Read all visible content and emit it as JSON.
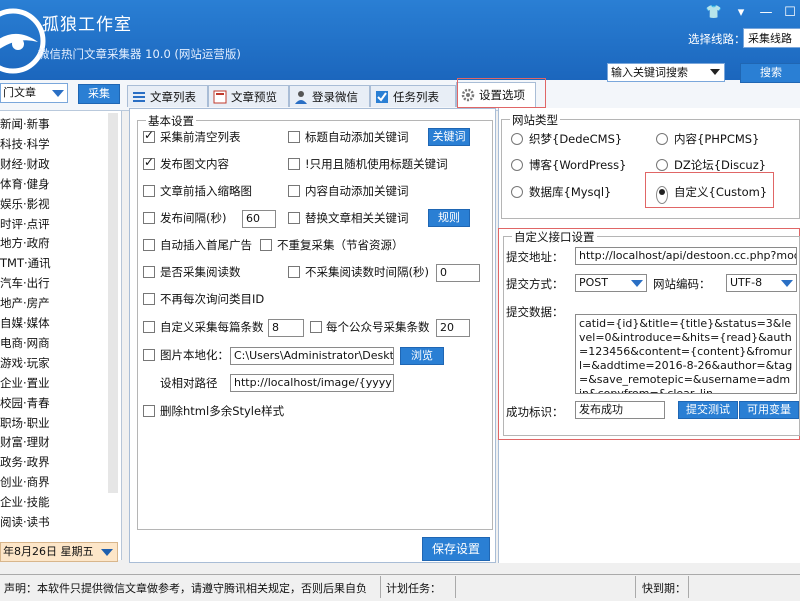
{
  "app": {
    "title": "孤狼工作室",
    "subtitle": "微信热门文章采集器  10.0 (网站运营版)",
    "route_label": "选择线路：",
    "route_value": "采集线路"
  },
  "toolbar": {
    "category_value": "门文章",
    "collect_button": "采集",
    "search_mode": "输入关键词搜索",
    "search_button": "搜索"
  },
  "tabs": [
    {
      "label": "文章列表",
      "icon": "list-icon"
    },
    {
      "label": "文章预览",
      "icon": "preview-icon"
    },
    {
      "label": "登录微信",
      "icon": "user-icon"
    },
    {
      "label": "任务列表",
      "icon": "checkbox-icon"
    },
    {
      "label": "设置选项",
      "icon": "gear-icon"
    }
  ],
  "sidebar": {
    "items": [
      "新闻·新事",
      "科技·科学",
      "财经·财政",
      "体育·健身",
      "娱乐·影视",
      "时评·点评",
      "地方·政府",
      "TMT·通讯",
      "汽车·出行",
      "地产·房产",
      "自媒·媒体",
      "电商·网商",
      "游戏·玩家",
      "企业·置业",
      "校园·青春",
      "职场·职业",
      "财富·理财",
      "政务·政界",
      "创业·商界",
      "企业·技能",
      "阅读·读书"
    ],
    "date": "年8月26日 星期五"
  },
  "basic": {
    "title": "基本设置",
    "clear_list": "采集前清空列表",
    "auto_title_kw": "标题自动添加关键词",
    "keyword_btn": "关键词",
    "publish_img": "发布图文内容",
    "random_kw": "!只用且随机使用标题关键词",
    "insert_thumb": "文章前插入缩略图",
    "auto_content_kw": "内容自动添加关键词",
    "interval_label": "发布间隔(秒)",
    "interval_value": "60",
    "replace_kw": "替换文章相关关键词",
    "rule_btn": "规则",
    "auto_ad": "自动插入首尾广告",
    "no_repeat": "不重复采集（节省资源）",
    "use_read": "是否采集阅读数",
    "no_read_interval": "不采集阅读数时间隔(秒)",
    "no_read_value": "0",
    "no_ask_id": "不再每次询问类目ID",
    "per_page": "自定义采集每篇条数",
    "per_page_value": "8",
    "per_account": "每个公众号采集条数",
    "per_account_value": "20",
    "img_local": "图片本地化：",
    "img_path": "C:\\Users\\Administrator\\Deskto",
    "browse_btn": "浏览",
    "relative_label": "设相对路径",
    "relative_value": "http://localhost/image/{yyyy}/{m",
    "del_style": "删除html多余Style样式",
    "save_btn": "保存设置"
  },
  "site": {
    "title": "网站类型",
    "options": [
      "织梦{DedeCMS}",
      "内容{PHPCMS}",
      "博客{WordPress}",
      "DZ论坛{Discuz}",
      "数据库{Mysql}",
      "自定义{Custom}"
    ],
    "selected": "自定义{Custom}"
  },
  "custom": {
    "title": "自定义接口设置",
    "url_label": "提交地址：",
    "url_value": "http://localhost/api/destoon.cc.php?modu",
    "method_label": "提交方式：",
    "method_value": "POST",
    "encoding_label": "网站编码：",
    "encoding_value": "UTF-8",
    "data_label": "提交数据：",
    "data_value": "catid={id}&title={title}&status=3&level=0&introduce=&hits={read}&auth=123456&content={content}&fromurl=&addtime=2016-8-26&author=&tag=&save_remotepic=&username=admin&copyfrom=&clear_lin",
    "success_label": "成功标识：",
    "success_value": "发布成功",
    "test_btn": "提交测试",
    "vars_btn": "可用变量"
  },
  "status": {
    "notice": "声明：本软件只提供微信文章做参考，请遵守腾讯相关规定，否则后果自负",
    "task_label": "计划任务：",
    "expire_label": "快到期："
  },
  "colors": {
    "accent": "#2a7fd4",
    "highlight": "#e06666"
  }
}
